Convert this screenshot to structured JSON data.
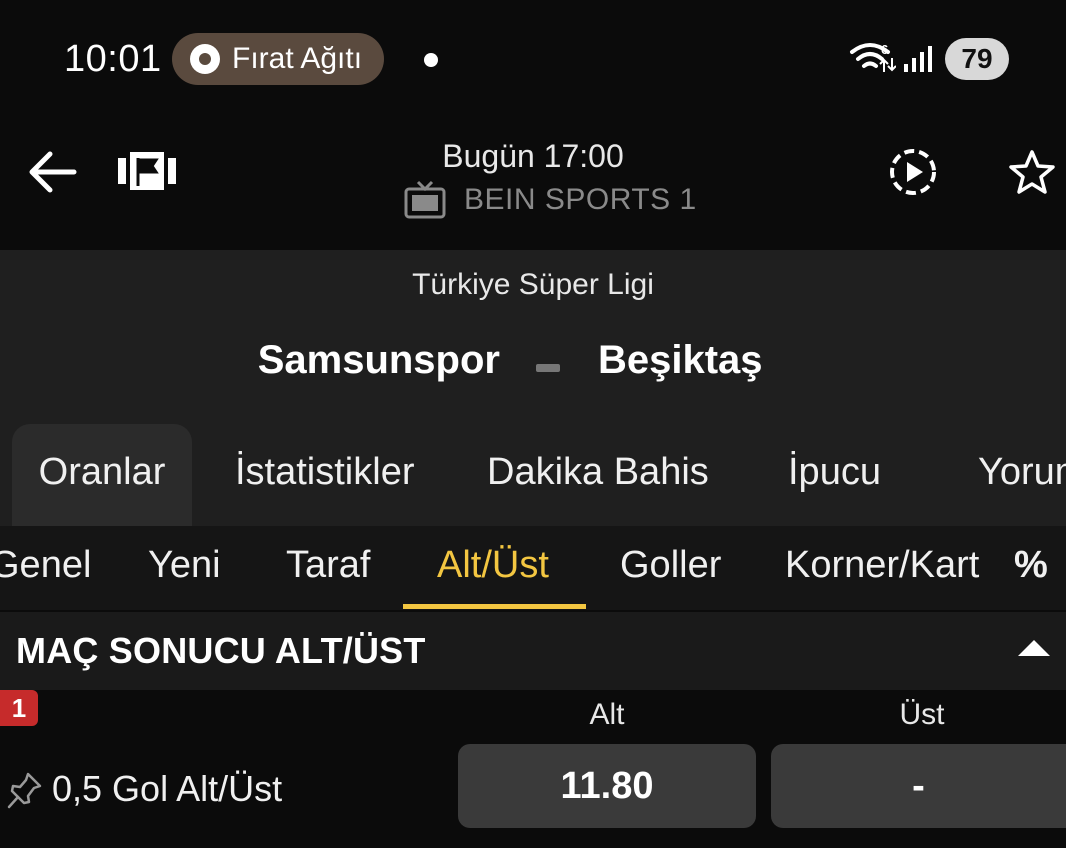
{
  "status_bar": {
    "time": "10:01",
    "notification": "Fırat Ağıtı",
    "battery": "79",
    "wifi_badge": "6"
  },
  "header": {
    "time": "Bugün 17:00",
    "channel": "BEIN SPORTS 1"
  },
  "match": {
    "league": "Türkiye Süper Ligi",
    "home_team": "Samsunspor",
    "away_team": "Beşiktaş"
  },
  "main_tabs": [
    {
      "label": "Oranlar",
      "active": true
    },
    {
      "label": "İstatistikler",
      "active": false
    },
    {
      "label": "Dakika Bahis",
      "active": false
    },
    {
      "label": "İpucu",
      "active": false
    },
    {
      "label": "Yorum",
      "active": false
    }
  ],
  "sub_tabs": [
    {
      "label": "Genel",
      "active": false
    },
    {
      "label": "Yeni",
      "active": false
    },
    {
      "label": "Taraf",
      "active": false
    },
    {
      "label": "Alt/Üst",
      "active": true
    },
    {
      "label": "Goller",
      "active": false
    },
    {
      "label": "Korner/Kart",
      "active": false
    },
    {
      "label": "%",
      "active": false
    }
  ],
  "market": {
    "title": "MAÇ SONUCU ALT/ÜST",
    "badge": "1",
    "col_alt": "Alt",
    "col_ust": "Üst",
    "rows": [
      {
        "label": "0,5 Gol Alt/Üst",
        "alt": "11.80",
        "ust": "-"
      }
    ]
  },
  "colors": {
    "accent": "#f3c641",
    "badge": "#c62b2b",
    "background": "#0b0b0b",
    "panel": "#1f1f1f"
  }
}
